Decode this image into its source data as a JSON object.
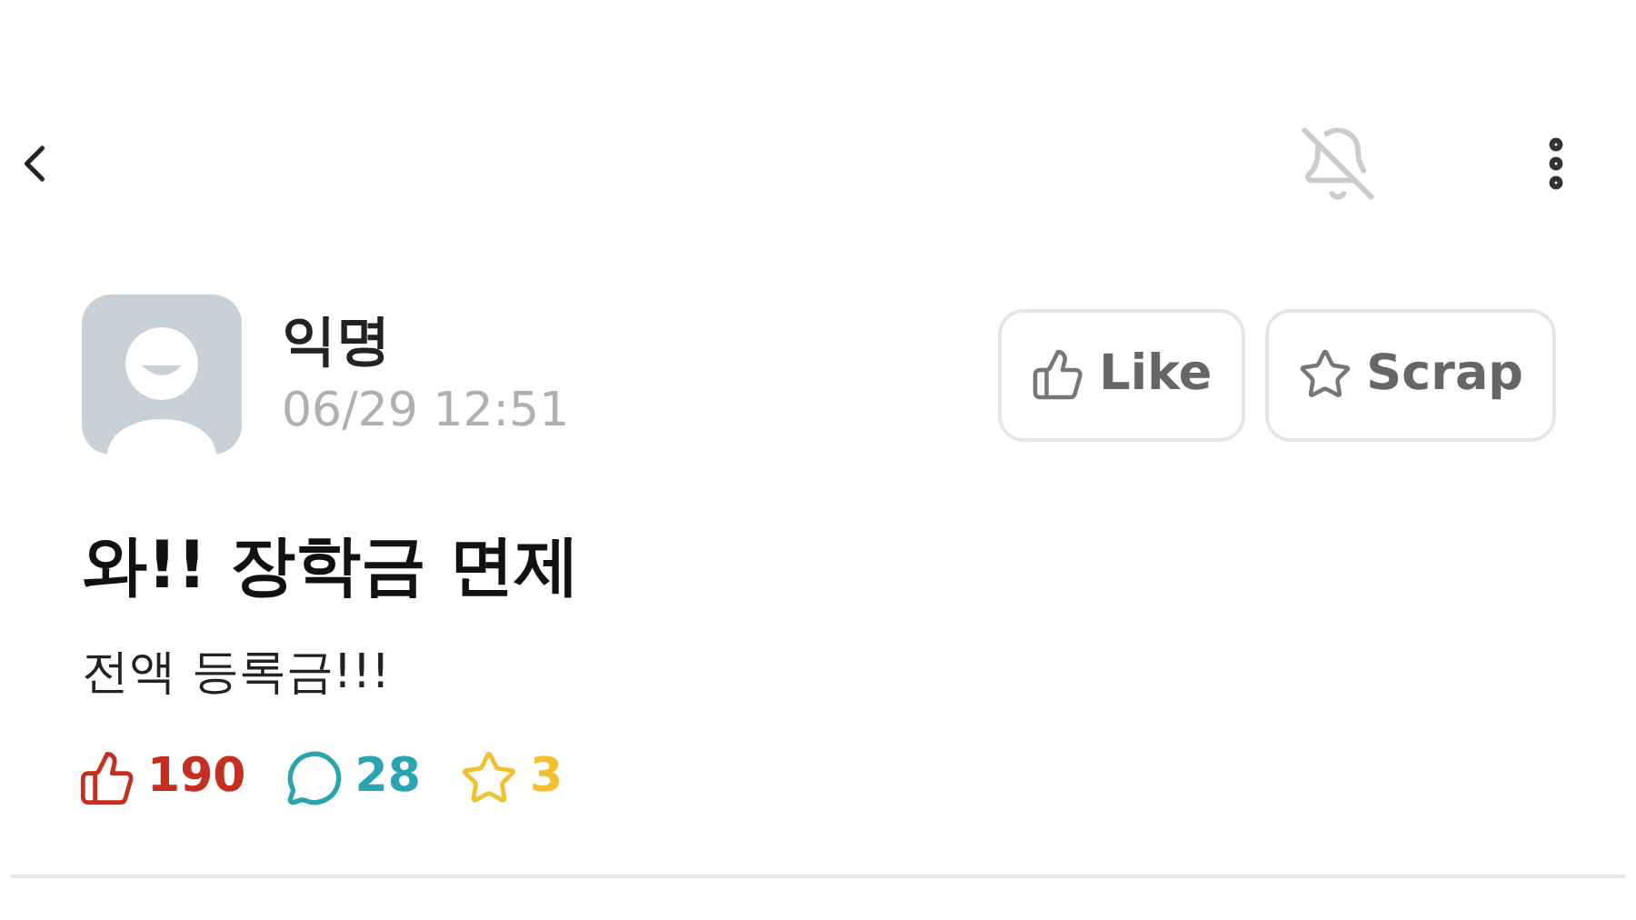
{
  "post": {
    "author": "익명",
    "time": "06/29 12:51",
    "actions": [
      {
        "kind": "like",
        "label": "Like"
      },
      {
        "kind": "scrap",
        "label": "Scrap"
      }
    ],
    "title": "와!! 장학금 면제",
    "body": "전액 등록금!!!",
    "stats": [
      {
        "kind": "like",
        "value": "190",
        "color": "#c62f1f"
      },
      {
        "kind": "comment",
        "value": "28",
        "color": "#2aa4b0"
      },
      {
        "kind": "scrap",
        "value": "3",
        "color": "#f2c12e"
      }
    ]
  }
}
